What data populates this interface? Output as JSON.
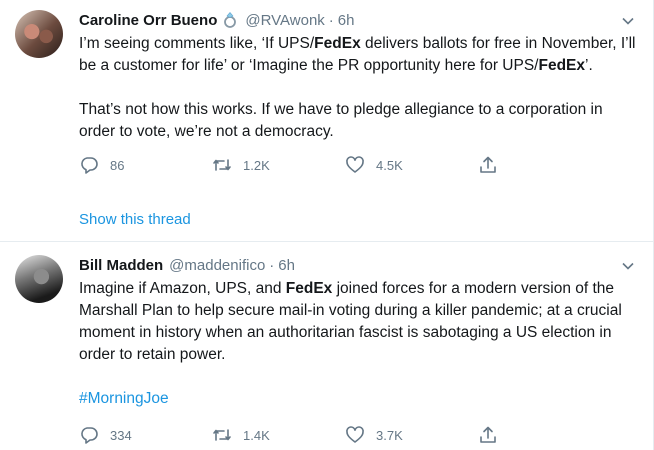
{
  "tweets": [
    {
      "name": "Caroline Orr Bueno",
      "handle": "@RVAwonk",
      "dot": "·",
      "time": "6h",
      "text_segments": [
        [
          "I’m seeing comments like, ‘If UPS/",
          "FedEx",
          " delivers ballots for free in November, I’ll be a customer for life’ or ‘Imagine the PR opportunity here for UPS/",
          "FedEx",
          "’."
        ],
        [
          "That’s not how this works. If we have to pledge allegiance to a corporation in order to vote, we’re not a democracy."
        ]
      ],
      "replies": "86",
      "retweets": "1.2K",
      "likes": "4.5K",
      "show_thread": "Show this thread"
    },
    {
      "name": "Bill Madden",
      "handle": "@maddenifico",
      "dot": "·",
      "time": "6h",
      "text_segments": [
        [
          "Imagine if Amazon, UPS, and ",
          "FedEx",
          " joined forces for a modern version of the Marshall Plan to help secure mail-in voting during a killer pandemic; at a crucial moment in history when an authoritarian fascist is sabotaging a US election in order to retain power."
        ]
      ],
      "hashtag": "#MorningJoe",
      "replies": "334",
      "retweets": "1.4K",
      "likes": "3.7K"
    }
  ],
  "icons": {
    "reply": "reply-icon",
    "retweet": "retweet-icon",
    "like": "like-icon",
    "share": "share-icon",
    "caret": "chevron-down-icon",
    "badge": "ring-emoji-icon"
  },
  "colors": {
    "link": "#1b95e0",
    "secondary": "#657786",
    "text": "#14171a",
    "divider": "#e6ecf0"
  }
}
